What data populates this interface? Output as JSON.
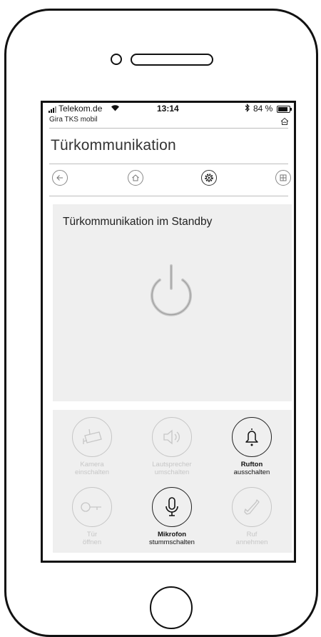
{
  "status_bar": {
    "carrier": "Telekom.de",
    "time": "13:14",
    "battery_percent": "84 %",
    "battery_level": 0.84
  },
  "app": {
    "name": "Gira TKS mobil",
    "page_title": "Türkommunikation"
  },
  "nav": [
    {
      "icon": "back-arrow-icon"
    },
    {
      "icon": "home-icon"
    },
    {
      "icon": "settings-gear-icon"
    },
    {
      "icon": "grid-icon"
    }
  ],
  "standby": {
    "title": "Türkommunikation im Standby",
    "icon": "power-icon"
  },
  "controls": [
    {
      "icon": "camera-icon",
      "line1": "Kamera",
      "line2": "einschalten",
      "enabled": false
    },
    {
      "icon": "speaker-icon",
      "line1": "Lautsprecher",
      "line2": "umschalten",
      "enabled": false
    },
    {
      "icon": "bell-icon",
      "line1": "Rufton",
      "line2": "ausschalten",
      "enabled": true
    },
    {
      "icon": "key-icon",
      "line1": "Tür",
      "line2": "öffnen",
      "enabled": false
    },
    {
      "icon": "microphone-icon",
      "line1": "Mikrofon",
      "line2": "stummschalten",
      "enabled": true
    },
    {
      "icon": "phone-handset-icon",
      "line1": "Ruf",
      "line2": "annehmen",
      "enabled": false
    }
  ],
  "colors": {
    "panel_bg": "#efefef",
    "active": "#222222",
    "disabled": "#c6c6c6"
  }
}
